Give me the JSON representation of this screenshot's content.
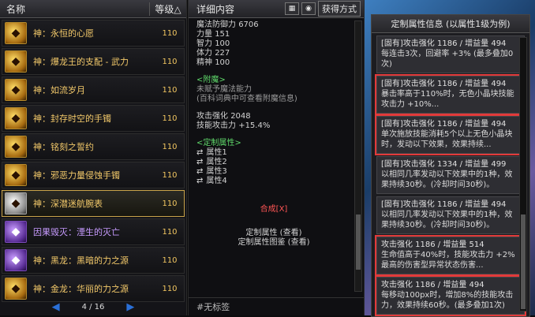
{
  "list": {
    "header_name": "名称",
    "header_level": "等级△",
    "items": [
      {
        "name": "神：永恒的心愿",
        "level": "110",
        "icon": "ring-icon"
      },
      {
        "name": "神：爆龙王的支配 - 武力",
        "level": "110",
        "icon": "gauntlet-icon"
      },
      {
        "name": "神：如流岁月",
        "level": "110",
        "icon": "sword-icon"
      },
      {
        "name": "神：封存时空的手镯",
        "level": "110",
        "icon": "bracelet-icon"
      },
      {
        "name": "神：铭刻之誓约",
        "level": "110",
        "icon": "scroll-icon"
      },
      {
        "name": "神：邪恶力量侵蚀手镯",
        "level": "110",
        "icon": "bracelet-icon"
      },
      {
        "name": "神：深潜迷航腕表",
        "level": "110",
        "icon": "watch-icon"
      },
      {
        "name": "因果毁灭：湮生的灭亡",
        "level": "110",
        "icon": "orb-icon"
      },
      {
        "name": "神：黑龙：黑暗的力之源",
        "level": "110",
        "icon": "dragon-icon"
      },
      {
        "name": "神：金龙：华丽的力之源",
        "level": "110",
        "icon": "dragon-icon"
      }
    ],
    "page": "4 / 16"
  },
  "detail": {
    "header": "详细内容",
    "btn_method": "获得方式",
    "stats": [
      {
        "label": "魔法防御力",
        "value": "6706"
      },
      {
        "label": "力量",
        "value": "151"
      },
      {
        "label": "智力",
        "value": "100"
      },
      {
        "label": "体力",
        "value": "227"
      },
      {
        "label": "精神",
        "value": "100"
      }
    ],
    "enchant_title": "<附魔>",
    "enchant_none": "未赋予魔法能力",
    "enchant_hint": "(百科词典中可查看附魔信息)",
    "atk_label": "攻击强化",
    "atk_value": "2048",
    "skill_label": "技能攻击力",
    "skill_value": "+15.4%",
    "custom_title": "<定制属性>",
    "attrs": [
      "属性1",
      "属性2",
      "属性3",
      "属性4"
    ],
    "compose": "合成[X]",
    "custom_attr_link": "定制属性 (查看)",
    "custom_illus_link": "定制属性图鉴 (查看)",
    "no_tag": "#无标签"
  },
  "custom_info": {
    "title": "定制属性信息 (以属性1级为例)",
    "entries": [
      {
        "line1": "[固有]攻击强化 1186 / 增益量 494",
        "line2": "每连击3次，回避率 +3% (最多叠加0次)",
        "highlight": false
      },
      {
        "line1": "[固有]攻击强化 1186 / 增益量 494",
        "line2": "暴击率高于110%时，无色小晶块技能攻击力 +10%...",
        "highlight": true
      },
      {
        "line1": "[固有]攻击强化 1186 / 增益量 494",
        "line2": "单次施放技能消耗5个以上无色小晶块时，发动以下效果，效果持续...",
        "highlight": true
      },
      {
        "line1": "[固有]攻击强化 1334 / 增益量 499",
        "line2": "以相同几率发动以下效果中的1种，效果持续30秒。(冷却时间30秒)。",
        "highlight": false
      },
      {
        "line1": "[固有]攻击强化 1186 / 增益量 494",
        "line2": "以相同几率发动以下效果中的1种，效果持续30秒。(冷却时间30秒)。",
        "highlight": false
      },
      {
        "line1": "攻击强化 1186 / 增益量 514",
        "line2": "生命值高于40%时，技能攻击力 +2% 最高的伤害型异常状态伤害...",
        "highlight": true
      },
      {
        "line1": "攻击强化 1186 / 增益量 494",
        "line2": "每移动100px时，增加8%的技能攻击力，效果持续60秒。(最多叠加1次)",
        "highlight": true
      }
    ]
  }
}
